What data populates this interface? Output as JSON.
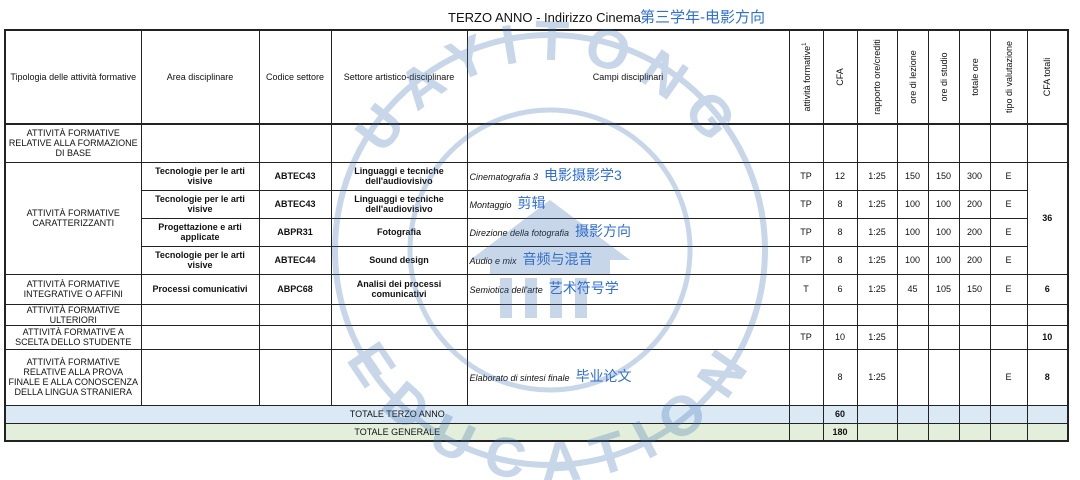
{
  "title": {
    "italian": "TERZO ANNO - Indirizzo Cinema",
    "chinese": "第三学年-电影方向"
  },
  "headers": {
    "tipologia": "Tipologia delle attività formative",
    "area": "Area disciplinare",
    "codice": "Codice settore",
    "settore": "Settore artistico-disciplinare",
    "campi": "Campi disciplinari",
    "attivita": "attività formative",
    "attivita_sup": "1",
    "cfa": "CFA",
    "rapporto": "rapporto ore/crediti",
    "lezione": "ore di lezione",
    "studio": "ore di studio",
    "totale_ore": "totale ore",
    "tipo": "tipo di valutazione",
    "cfa_totali": "CFA totali"
  },
  "rows": {
    "base": {
      "tipologia": "ATTIVITÀ FORMATIVE RELATIVE ALLA FORMAZIONE DI BASE"
    },
    "caratterizzanti": {
      "tipologia": "ATTIVITÀ FORMATIVE CARATTERIZZANTI",
      "cfa_totali": "36",
      "items": [
        {
          "area": "Tecnologie per le arti visive",
          "codice": "ABTEC43",
          "settore": "Linguaggi e tecniche dell'audiovisivo",
          "campo": "Cinematografia 3",
          "campo_cn": "电影摄影学3",
          "att": "TP",
          "cfa": "12",
          "rapporto": "1:25",
          "lezione": "150",
          "studio": "150",
          "totale": "300",
          "tipo": "E"
        },
        {
          "area": "Tecnologie per le arti visive",
          "codice": "ABTEC43",
          "settore": "Linguaggi e tecniche dell'audiovisivo",
          "campo": "Montaggio",
          "campo_cn": "剪辑",
          "att": "TP",
          "cfa": "8",
          "rapporto": "1:25",
          "lezione": "100",
          "studio": "100",
          "totale": "200",
          "tipo": "E"
        },
        {
          "area": "Progettazione e arti applicate",
          "codice": "ABPR31",
          "settore": "Fotografia",
          "campo": "Direzione della fotografia",
          "campo_cn": "摄影方向",
          "att": "TP",
          "cfa": "8",
          "rapporto": "1:25",
          "lezione": "100",
          "studio": "100",
          "totale": "200",
          "tipo": "E"
        },
        {
          "area": "Tecnologie per le arti visive",
          "codice": "ABTEC44",
          "settore": "Sound design",
          "campo": "Audio e mix",
          "campo_cn": "音频与混音",
          "att": "TP",
          "cfa": "8",
          "rapporto": "1:25",
          "lezione": "100",
          "studio": "100",
          "totale": "200",
          "tipo": "E"
        }
      ]
    },
    "integrative": {
      "tipologia": "ATTIVITÀ FORMATIVE INTEGRATIVE O AFFINI",
      "area": "Processi comunicativi",
      "codice": "ABPC68",
      "settore": "Analisi dei processi comunicativi",
      "campo": "Semiotica dell'arte",
      "campo_cn": "艺术符号学",
      "att": "T",
      "cfa": "6",
      "rapporto": "1:25",
      "lezione": "45",
      "studio": "105",
      "totale": "150",
      "tipo": "E",
      "cfa_totali": "6"
    },
    "ulteriori": {
      "tipologia": "ATTIVITÀ FORMATIVE ULTERIORI"
    },
    "scelta": {
      "tipologia": "ATTIVITÀ FORMATIVE A SCELTA DELLO STUDENTE",
      "att": "TP",
      "cfa": "10",
      "rapporto": "1:25",
      "cfa_totali": "10"
    },
    "finale": {
      "tipologia": "ATTIVITÀ FORMATIVE RELATIVE ALLA PROVA FINALE E ALLA CONOSCENZA DELLA LINGUA STRANIERA",
      "campo": "Elaborato di sintesi finale",
      "campo_cn": "毕业论文",
      "cfa": "8",
      "rapporto": "1:25",
      "tipo": "E",
      "cfa_totali": "8"
    }
  },
  "totals": {
    "anno": {
      "label": "TOTALE TERZO ANNO",
      "cfa": "60"
    },
    "generale": {
      "label": "TOTALE GENERALE",
      "cfa": "180"
    }
  },
  "watermark": {
    "top_text": "UAYITONG",
    "bottom_text": "EDUCATION",
    "color": "#3a6fb0"
  }
}
